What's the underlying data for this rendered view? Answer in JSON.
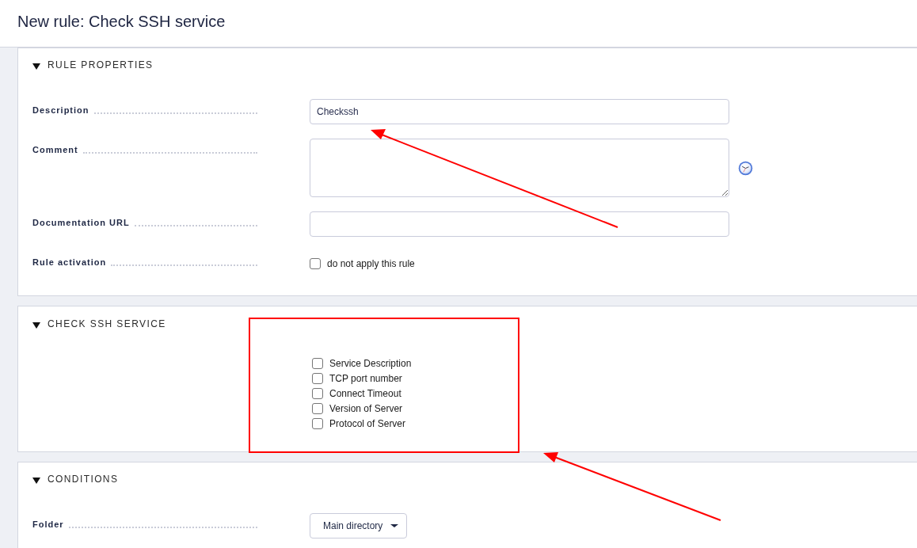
{
  "page": {
    "title": "New rule: Check SSH service"
  },
  "sections": [
    {
      "kind": "form",
      "title": "RULE PROPERTIES",
      "expanded": true,
      "fields": [
        {
          "kind": "text",
          "label": "Description",
          "value": "Checkssh"
        },
        {
          "kind": "textarea",
          "label": "Comment"
        },
        {
          "kind": "text",
          "label": "Documentation URL"
        },
        {
          "kind": "checkbox",
          "label": "Rule activation",
          "option": "do not apply this rule",
          "checked": false
        }
      ]
    },
    {
      "kind": "checklist",
      "title": "CHECK SSH SERVICE",
      "expanded": true,
      "options": [
        {
          "label": "Service Description",
          "checked": false
        },
        {
          "label": "TCP port number",
          "checked": false
        },
        {
          "label": "Connect Timeout",
          "checked": false
        },
        {
          "label": "Version of Server",
          "checked": false
        },
        {
          "label": "Protocol of Server",
          "checked": false
        }
      ]
    },
    {
      "kind": "form",
      "title": "CONDITIONS",
      "expanded": true,
      "fields": [
        {
          "kind": "select",
          "label": "Folder",
          "value": "Main directory"
        }
      ]
    }
  ]
}
